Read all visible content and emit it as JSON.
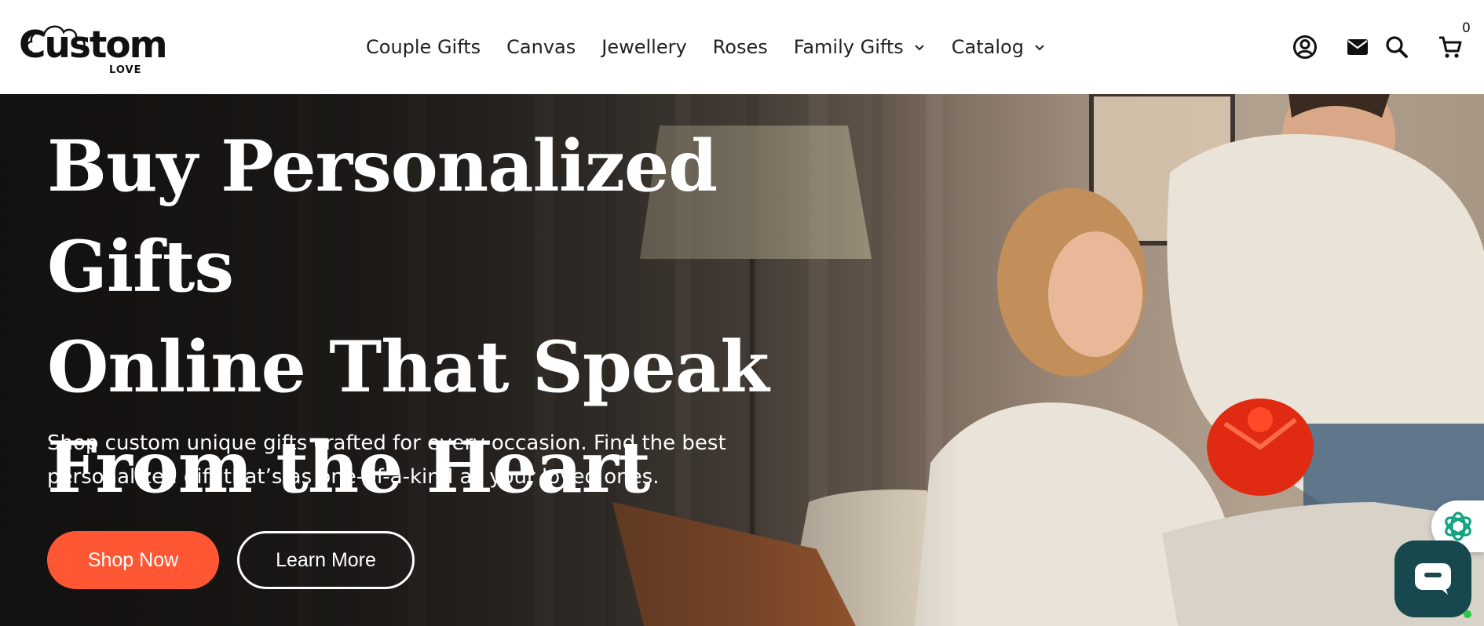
{
  "brand": {
    "logo_word": "Custom",
    "logo_sub": "LOVE"
  },
  "nav": {
    "items": [
      {
        "label": "Couple Gifts",
        "has_dropdown": false
      },
      {
        "label": "Canvas",
        "has_dropdown": false
      },
      {
        "label": "Jewellery",
        "has_dropdown": false
      },
      {
        "label": "Roses",
        "has_dropdown": false
      },
      {
        "label": "Family Gifts",
        "has_dropdown": true
      },
      {
        "label": "Catalog",
        "has_dropdown": true
      }
    ]
  },
  "header_icons": {
    "account": "account-icon",
    "mail": "mail-icon",
    "search": "search-icon",
    "cart": "cart-icon",
    "cart_count": "0"
  },
  "hero": {
    "title_line1": "Buy Personalized Gifts",
    "title_line2": "Online That Speak",
    "title_line3": "From the Heart",
    "description_line1": "Shop custom unique gifts crafted for every occasion. Find the best",
    "description_line2": "personalized gift that’s as one-of-a-kind as your loved ones.",
    "primary_button": "Shop Now",
    "secondary_button": "Learn More"
  },
  "colors": {
    "accent": "#ff5733",
    "chat_widget": "#17484d",
    "ai_widget_icon": "#10a37f",
    "text_dark": "#222222"
  }
}
